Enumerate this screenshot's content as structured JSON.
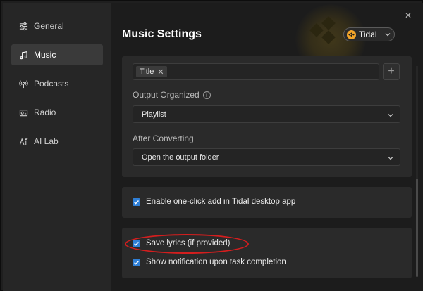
{
  "sidebar": {
    "items": [
      {
        "label": "General",
        "icon": "sliders-icon"
      },
      {
        "label": "Music",
        "icon": "music-note-icon",
        "active": true
      },
      {
        "label": "Podcasts",
        "icon": "broadcast-icon"
      },
      {
        "label": "Radio",
        "icon": "radio-icon"
      },
      {
        "label": "AI Lab",
        "icon": "ai-icon"
      }
    ]
  },
  "header": {
    "title": "Music Settings",
    "source_label": "Tidal",
    "close_symbol": "✕"
  },
  "filename_tags": [
    {
      "label": "Title",
      "remove": "✕"
    }
  ],
  "add_symbol": "+",
  "output_organized": {
    "label": "Output Organized",
    "info_symbol": "i",
    "value": "Playlist"
  },
  "after_converting": {
    "label": "After Converting",
    "value": "Open the output folder"
  },
  "options": {
    "one_click_add": "Enable one-click add in Tidal desktop app",
    "save_lyrics": "Save lyrics (if provided)",
    "show_notification": "Show notification upon task completion"
  },
  "colors": {
    "accent": "#2f7fd6",
    "highlight": "#d41e1e",
    "tidal_logo": "#f4a62a"
  }
}
